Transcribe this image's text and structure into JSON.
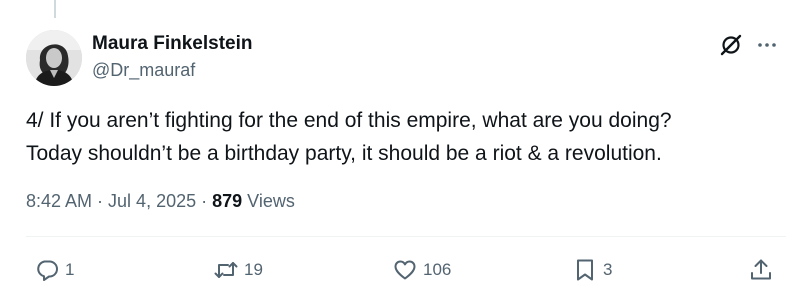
{
  "author": {
    "name": "Maura Finkelstein",
    "handle": "@Dr_mauraf"
  },
  "tweet": {
    "lines": [
      "4/ If you aren’t fighting for the end of this empire, what are you doing?",
      "Today shouldn’t be a birthday party, it should be a riot & a revolution."
    ],
    "time": "8:42 AM",
    "separator1": " · ",
    "date": "Jul 4, 2025",
    "separator2": " · ",
    "views_count": "879",
    "views_label": " Views"
  },
  "actions": {
    "replies": "1",
    "reposts": "19",
    "likes": "106",
    "bookmarks": "3"
  },
  "icons": {
    "grok": "grok-icon",
    "more": "more-icon",
    "reply": "reply-icon",
    "repost": "repost-icon",
    "like": "like-icon",
    "bookmark": "bookmark-icon",
    "share": "share-icon"
  },
  "colors": {
    "text": "#0f1419",
    "secondary": "#536471",
    "divider": "#eff3f4"
  }
}
